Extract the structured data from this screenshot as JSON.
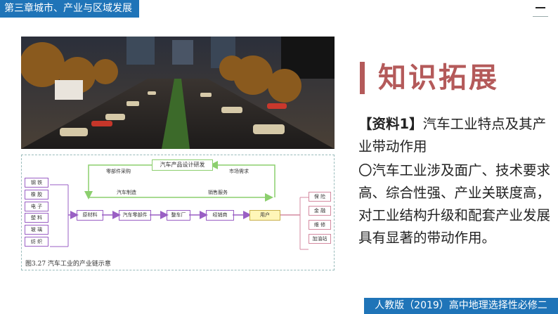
{
  "header": {
    "chapter_title": "第三章城市、产业与区域发展"
  },
  "slide": {
    "title": "知识拓展",
    "source_label": "【资料1】",
    "source_heading": "汽车工业特点及其产业带动作用",
    "paragraph": "〇汽车工业涉及面广、技术要求高、综合性强、产业关联度高，对工业结构升级和配套产业发展具有显著的带动作用。"
  },
  "diagram": {
    "top_box": "汽车产品设计研发",
    "labels": {
      "parts_purchase": "零部件采购",
      "market_demand": "市场需求",
      "car_manufacturing": "汽车制造",
      "sales_service": "销售服务"
    },
    "materials": [
      "钢 铁",
      "橡 胶",
      "电 子",
      "塑 料",
      "玻 璃",
      "纺 织"
    ],
    "chain": [
      "原材料",
      "汽车零部件",
      "整车厂",
      "经销商",
      "用户"
    ],
    "services": [
      "保 险",
      "金 融",
      "维 修",
      "加油站"
    ],
    "caption": "图3.27   汽车工业的产业链示意"
  },
  "footer": {
    "edition": "人教版（2019）高中地理选择性必修二"
  },
  "colors": {
    "header_blue": "#1f74b8",
    "title_red": "#b45a5a",
    "arrow_green": "#8ccf6e",
    "chain_purple": "#9a5fc4",
    "user_yellow": "#fff6b8"
  }
}
